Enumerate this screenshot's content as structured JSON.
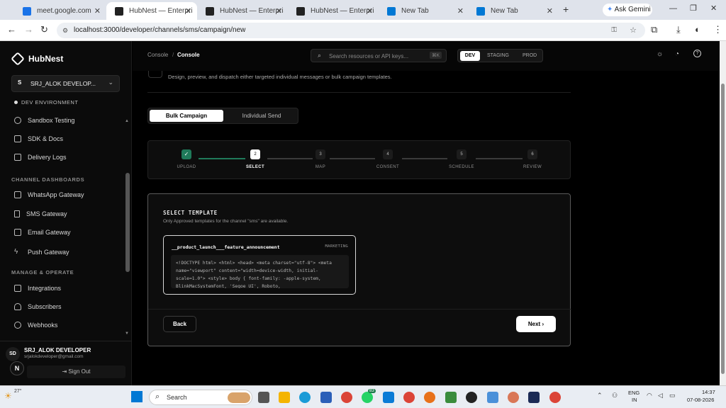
{
  "browser": {
    "tabs": [
      {
        "title": "meet.google.com",
        "color": "#1a73e8"
      },
      {
        "title": "HubNest — Enterprise",
        "color": "#222222"
      },
      {
        "title": "HubNest — Enterprise",
        "color": "#222222"
      },
      {
        "title": "HubNest — Enterprise",
        "color": "#222222"
      },
      {
        "title": "New Tab",
        "color": "#9aa0a6"
      },
      {
        "title": "New Tab",
        "color": "#9aa0a6"
      }
    ],
    "ask_gemini": "Ask Gemini",
    "url": "localhost:3000/developer/channels/sms/campaign/new"
  },
  "sidebar": {
    "brand": "HubNest",
    "workspace_initial": "S",
    "workspace": "SRJ_ALOK DEVELOP...",
    "environment": "DEV ENVIRONMENT",
    "top_items": [
      "Sandbox Testing",
      "SDK & Docs",
      "Delivery Logs"
    ],
    "section_channels": "CHANNEL DASHBOARDS",
    "channel_items": [
      "WhatsApp Gateway",
      "SMS Gateway",
      "Email Gateway",
      "Push Gateway"
    ],
    "section_manage": "MANAGE & OPERATE",
    "manage_items": [
      "Integrations",
      "Subscribers",
      "Webhooks"
    ],
    "user_initials": "SD",
    "user_name": "SRJ_ALOK DEVELOPER",
    "user_email": "srjalokdeveloper@gmail.com",
    "sign_out": "Sign Out"
  },
  "topbar": {
    "breadcrumb_1": "Console",
    "breadcrumb_sep": "/",
    "breadcrumb_2": "Console",
    "search_placeholder": "Search resources or API keys...",
    "search_shortcut": "⌘K",
    "envs": [
      "DEV",
      "STAGING",
      "PROD"
    ],
    "active_env": "DEV"
  },
  "page": {
    "subtitle": "Design, preview, and dispatch either targeted individual messages or bulk campaign templates.",
    "mode_tabs": [
      "Bulk Campaign",
      "Individual Send"
    ],
    "steps": [
      {
        "num": "✓",
        "label": "UPLOAD"
      },
      {
        "num": "2",
        "label": "SELECT"
      },
      {
        "num": "3",
        "label": "MAP"
      },
      {
        "num": "4",
        "label": "CONSENT"
      },
      {
        "num": "5",
        "label": "SCHEDULE"
      },
      {
        "num": "6",
        "label": "REVIEW"
      }
    ],
    "current_step": 2,
    "section_title": "SELECT TEMPLATE",
    "section_desc": "Only Approved templates for the channel \"sms\" are available.",
    "template_name": "__product_launch___feature_announcement",
    "template_category": "MARKETING",
    "template_preview": "<!DOCTYPE html> <html> <head> <meta charset=\"utf-8\"> <meta name=\"viewport\" content=\"width=device-width, initial-scale=1.0\"> <style> body { font-family: -apple-system, BlinkMacSystemFont, 'Segoe UI', Roboto,",
    "back_label": "Back",
    "next_label": "Next"
  },
  "taskbar": {
    "weather": "27°",
    "search": "Search",
    "lang_1": "ENG",
    "lang_2": "IN",
    "time": "14:37",
    "date": "07-08-2026",
    "badge": "83"
  },
  "colors": {
    "accent_green": "#1f7a5a",
    "panel": "#0d0d0d"
  }
}
